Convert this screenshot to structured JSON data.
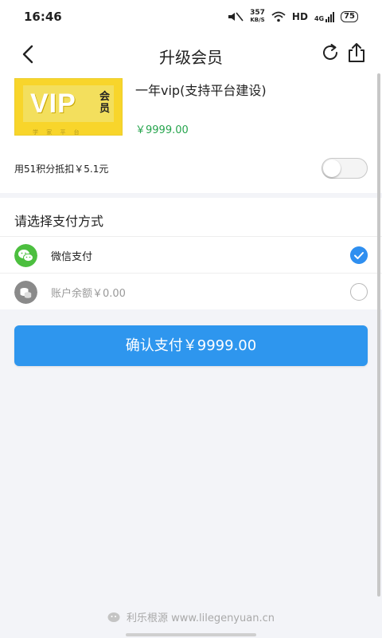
{
  "status_bar": {
    "time": "16:46",
    "speed_value": "357",
    "speed_unit": "KB/S",
    "hd_label": "HD",
    "signal_label": "4G",
    "battery": "75"
  },
  "nav": {
    "title": "升级会员"
  },
  "product": {
    "vip_text": "VIP",
    "vip_cn": "会员",
    "vip_sub": "学 家 平 台",
    "name": "一年vip(支持平台建设)",
    "price": "￥9999.00",
    "points_label": "用51积分抵扣￥5.1元",
    "points_toggle_on": false
  },
  "payment": {
    "heading": "请选择支付方式",
    "options": [
      {
        "label": "微信支付",
        "selected": true,
        "icon": "wechat-icon",
        "color": "#4cbf3f"
      },
      {
        "label": "账户余额￥0.00",
        "selected": false,
        "icon": "wallet-icon",
        "color": "#8a8a8a"
      }
    ]
  },
  "confirm": {
    "label": "确认支付￥9999.00",
    "color": "#2e96ee"
  },
  "watermark": {
    "text": "利乐根源  www.lilegenyuan.cn"
  }
}
